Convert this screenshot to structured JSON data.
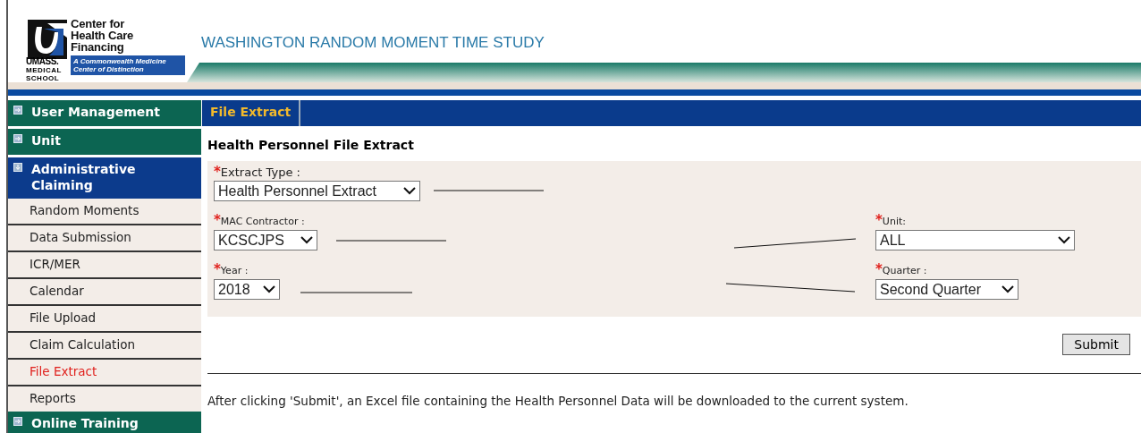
{
  "logo": {
    "lines": [
      "Center for",
      "Health Care",
      "Financing"
    ],
    "umass": "UMASS.",
    "medical": "MEDICAL",
    "school": "SCHOOL",
    "tagline": [
      "A Commonwealth Medicine",
      "Center of Distinction"
    ]
  },
  "header": {
    "title": "WASHINGTON RANDOM MOMENT TIME STUDY"
  },
  "sidebar": {
    "items": [
      {
        "kind": "section",
        "label": "User Management",
        "expanded": false
      },
      {
        "kind": "section",
        "label": "Unit",
        "expanded": false
      },
      {
        "kind": "section",
        "label": "Administrative Claiming",
        "expanded": true
      },
      {
        "kind": "link",
        "label": "Random Moments",
        "selected": false
      },
      {
        "kind": "link",
        "label": "Data Submission",
        "selected": false
      },
      {
        "kind": "link",
        "label": "ICR/MER",
        "selected": false
      },
      {
        "kind": "link",
        "label": "Calendar",
        "selected": false
      },
      {
        "kind": "link",
        "label": "File Upload",
        "selected": false
      },
      {
        "kind": "link",
        "label": "Claim Calculation",
        "selected": false
      },
      {
        "kind": "link",
        "label": "File Extract",
        "selected": true
      },
      {
        "kind": "link",
        "label": "Reports",
        "selected": false
      },
      {
        "kind": "section",
        "label": "Online Training",
        "expanded": false
      }
    ]
  },
  "tabs": [
    {
      "label": "File Extract",
      "selected": true
    }
  ],
  "form": {
    "title": "Health Personnel File Extract",
    "rows": [
      [
        {
          "mark": "*",
          "label": "Extract Type :",
          "value": "Health Personnel Extract"
        }
      ],
      [
        {
          "mark": "*",
          "label": "MAC Contractor :",
          "value": "KCSCJPS"
        },
        {
          "mark": "*",
          "label": "Unit:",
          "value": "ALL"
        }
      ],
      [
        {
          "mark": "*",
          "label": "Year :",
          "value": "2018"
        },
        {
          "mark": "*",
          "label": "Quarter :",
          "value": "Second Quarter"
        }
      ]
    ],
    "submit": "Submit"
  },
  "note": "After clicking 'Submit', an Excel file containing the Health Personnel Data will be downloaded to the current system."
}
